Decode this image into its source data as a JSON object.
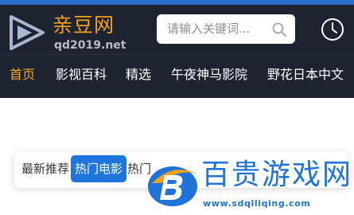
{
  "header": {
    "logo": {
      "name": "亲豆网",
      "domain": "qd2019.net"
    },
    "search": {
      "placeholder": "请输入关键词..."
    },
    "icons": {
      "search": "search-icon",
      "history": "clock-icon"
    }
  },
  "nav": {
    "items": [
      {
        "label": "首页",
        "active": true
      },
      {
        "label": "影视百科",
        "active": false
      },
      {
        "label": "精选",
        "active": false
      },
      {
        "label": "午夜神马影院",
        "active": false
      },
      {
        "label": "野花日本中文",
        "active": false
      }
    ]
  },
  "tabs": {
    "items": [
      {
        "label": "最新推荐",
        "active": false
      },
      {
        "label": "热门电影",
        "active": true
      },
      {
        "label": "热门",
        "active": false
      }
    ]
  },
  "watermark": {
    "title": "百贵游戏网",
    "url": "www.sdqlliqing.com"
  },
  "colors": {
    "accent": "#f5a623",
    "header_bg": "#1e2331",
    "primary": "#1f75de"
  }
}
